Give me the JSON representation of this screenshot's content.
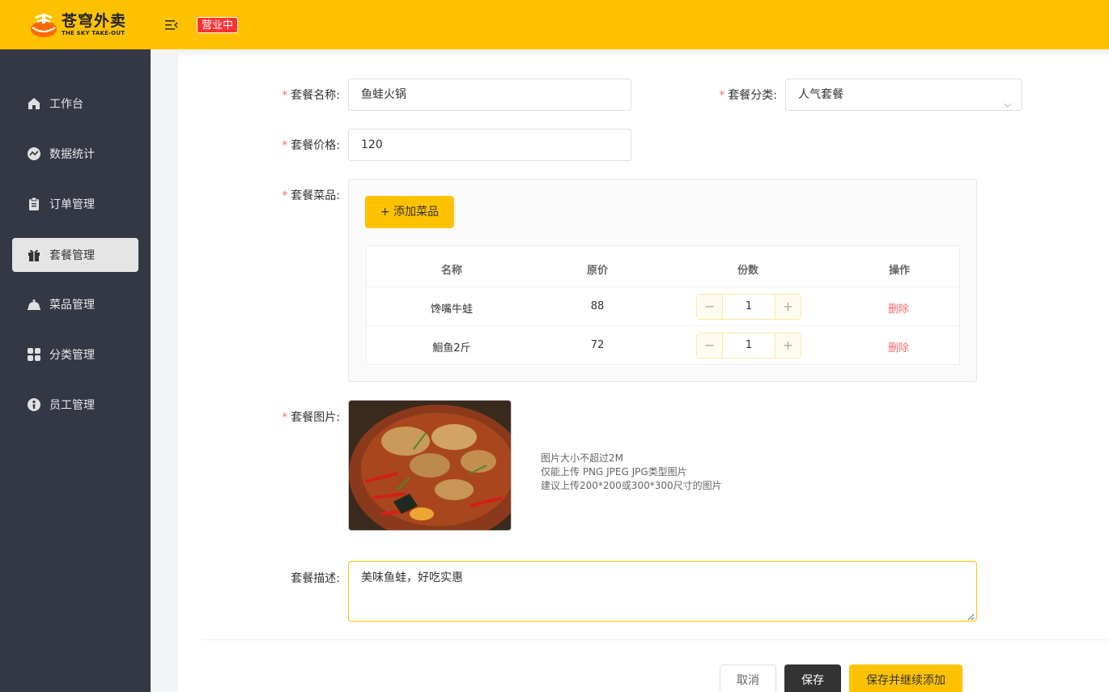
{
  "header": {
    "logo_cn": "苍穹外卖",
    "logo_en": "THE SKY TAKE-OUT",
    "status": "营业中",
    "accent_color": "#ffc200"
  },
  "sidebar": {
    "items": [
      {
        "label": "工作台",
        "icon": "home-icon",
        "active": false
      },
      {
        "label": "数据统计",
        "icon": "chart-icon",
        "active": false
      },
      {
        "label": "订单管理",
        "icon": "clipboard-icon",
        "active": false
      },
      {
        "label": "套餐管理",
        "icon": "gift-icon",
        "active": true
      },
      {
        "label": "菜品管理",
        "icon": "cloche-icon",
        "active": false
      },
      {
        "label": "分类管理",
        "icon": "grid-icon",
        "active": false
      },
      {
        "label": "员工管理",
        "icon": "employee-icon",
        "active": false
      }
    ]
  },
  "form": {
    "name_label": "套餐名称:",
    "name_value": "鱼蛙火锅",
    "category_label": "套餐分类:",
    "category_value": "人气套餐",
    "price_label": "套餐价格:",
    "price_value": "120",
    "dishes_label": "套餐菜品:",
    "add_dish_button": "+ 添加菜品",
    "table": {
      "headers": [
        "名称",
        "原价",
        "份数",
        "操作"
      ],
      "rows": [
        {
          "name": "馋嘴牛蛙",
          "price": "88",
          "qty": "1",
          "action": "删除"
        },
        {
          "name": "鮰鱼2斤",
          "price": "72",
          "qty": "1",
          "action": "删除"
        }
      ]
    },
    "image_label": "套餐图片:",
    "image_hints": [
      "图片大小不超过2M",
      "仅能上传 PNG JPEG JPG类型图片",
      "建议上传200*200或300*300尺寸的图片"
    ],
    "desc_label": "套餐描述:",
    "desc_value": "美味鱼蛙，好吃实惠"
  },
  "actions": {
    "cancel": "取消",
    "save": "保存",
    "save_and_add": "保存并继续添加"
  }
}
